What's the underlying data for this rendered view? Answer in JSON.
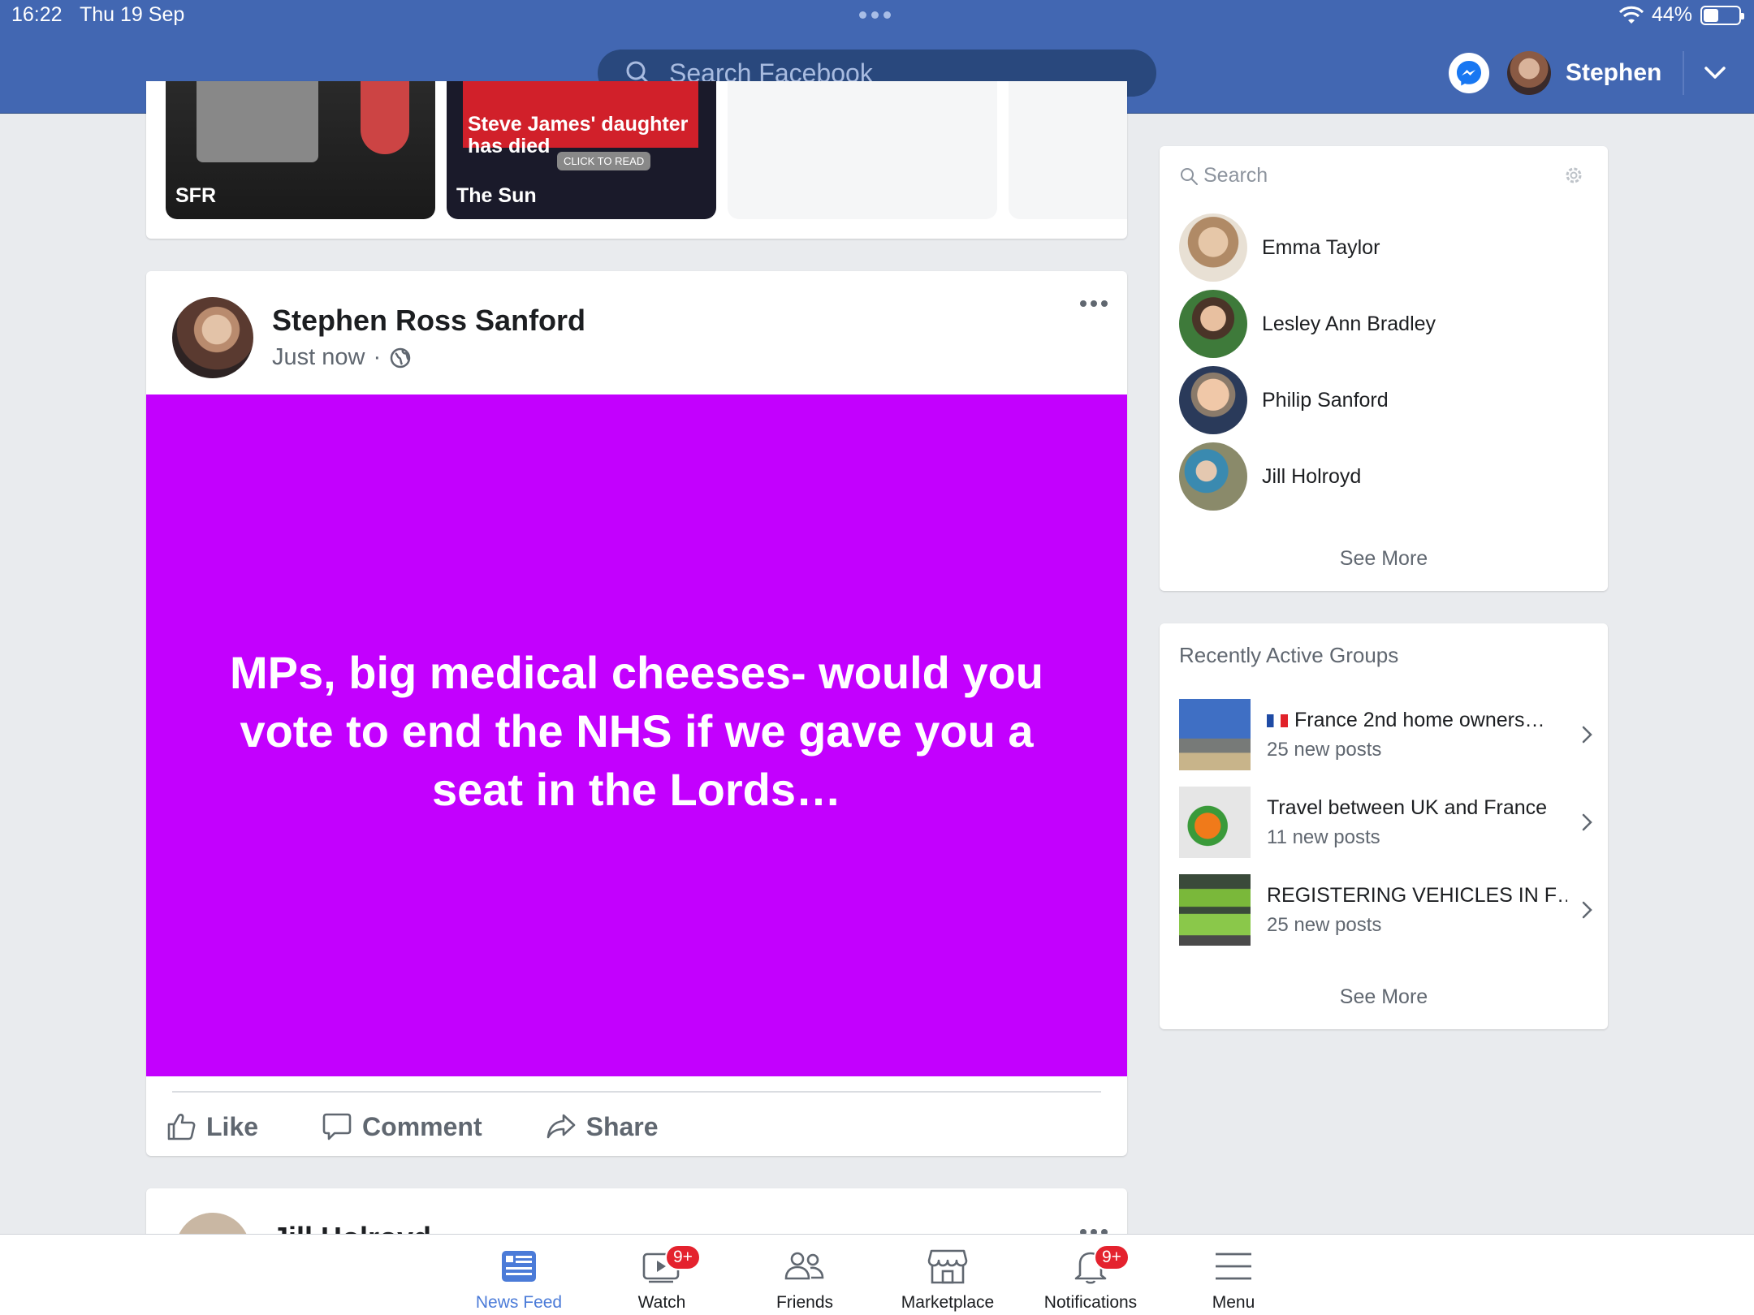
{
  "status_bar": {
    "time": "16:22",
    "date": "Thu 19 Sep",
    "battery": "44%"
  },
  "header": {
    "search_placeholder": "Search Facebook",
    "profile_name": "Stephen"
  },
  "stories": [
    {
      "label": "SFR"
    },
    {
      "label": "The Sun",
      "headline": "Steve James' daughter has died",
      "cta": "CLICK TO READ"
    }
  ],
  "post": {
    "author": "Stephen Ross Sanford",
    "time": "Just now",
    "text": "MPs, big medical cheeses- would you vote to end the NHS if we gave you a seat in the Lords…",
    "background_color": "#c300fe",
    "actions": {
      "like": "Like",
      "comment": "Comment",
      "share": "Share"
    }
  },
  "next_post": {
    "author": "Jill Holroyd"
  },
  "contacts": {
    "search_placeholder": "Search",
    "items": [
      {
        "name": "Emma Taylor"
      },
      {
        "name": "Lesley Ann Bradley"
      },
      {
        "name": "Philip Sanford"
      },
      {
        "name": "Jill Holroyd"
      }
    ],
    "see_more": "See More"
  },
  "groups": {
    "title": "Recently Active Groups",
    "items": [
      {
        "name": "France 2nd home owners…",
        "count": "25 new posts"
      },
      {
        "name": "Travel between UK and France",
        "count": "11 new posts"
      },
      {
        "name": "REGISTERING VEHICLES IN F…",
        "count": "25 new posts"
      }
    ],
    "see_more": "See More"
  },
  "tabbar": {
    "items": [
      {
        "label": "News Feed"
      },
      {
        "label": "Watch",
        "badge": "9+"
      },
      {
        "label": "Friends"
      },
      {
        "label": "Marketplace"
      },
      {
        "label": "Notifications",
        "badge": "9+"
      },
      {
        "label": "Menu"
      }
    ]
  },
  "colors": {
    "brand": "#4267b2",
    "post_background": "#c300fe",
    "active_tab": "#4b7bd8",
    "badge": "#e4222e"
  }
}
